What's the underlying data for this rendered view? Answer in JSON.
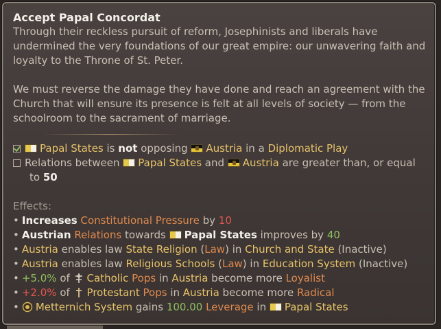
{
  "tooltip": {
    "title": "Accept Papal Concordat",
    "para1_line1": "Through their reckless pursuit of reform, Josephinists and liberals have",
    "para1_line2": "undermined the very foundations of our great empire: our unwavering faith and",
    "para1_line3": "loyalty to the Throne of St. Peter.",
    "para2_line1": "We must reverse the damage they have done and reach an agreement with the",
    "para2_line2": "Church that will ensure its presence is felt at all levels of society — from the",
    "para2_line3": "schoolroom to the sacrament of marriage."
  },
  "conditions": {
    "c1": {
      "subject": "Papal States",
      "t1": " is ",
      "not": "not",
      "t2": " opposing ",
      "target": "Austria",
      "t3": " in a ",
      "play": "Diplomatic Play"
    },
    "c2": {
      "t1": "Relations between ",
      "subject": "Papal States",
      "t2": " and ",
      "target": "Austria",
      "t3": " are greater than, or equal",
      "t4": "to ",
      "value": "50"
    }
  },
  "effects": {
    "header": "Effects:",
    "e1": {
      "verb": "Increases",
      "stat": "Constitutional Pressure",
      "t1": " by ",
      "value": "10"
    },
    "e2": {
      "a": "Austrian",
      "rel": "Relations",
      "t1": " towards ",
      "target": "Papal States",
      "t2": " improves by ",
      "value": "40"
    },
    "e3": {
      "country": "Austria",
      "t1": " enables law ",
      "law": "State Religion",
      "t2": " (",
      "lawword": "Law",
      "t3": ") in ",
      "group": "Church and State",
      "t4": " (Inactive)"
    },
    "e4": {
      "country": "Austria",
      "t1": " enables law ",
      "law": "Religious Schools",
      "t2": " (",
      "lawword": "Law",
      "t3": ") in ",
      "group": "Education System",
      "t4": " (Inactive)"
    },
    "e5": {
      "pct": "+5.0%",
      "t1": " of ",
      "rel": "Catholic",
      "pops": "Pops",
      "t2": " in ",
      "country": "Austria",
      "t3": " become more ",
      "result": "Loyalist"
    },
    "e6": {
      "pct": "+2.0%",
      "t1": " of ",
      "rel": "Protestant",
      "pops": "Pops",
      "t2": " in ",
      "country": "Austria",
      "t3": " become more ",
      "result": "Radical"
    },
    "e7": {
      "name": "Metternich System",
      "t1": " gains ",
      "value": "100.00",
      "stat": "Leverage",
      "t2": " in ",
      "target": "Papal States"
    }
  },
  "colors": {
    "highlight": "#e8c36a",
    "stat": "#e08a4e",
    "positive": "#8fc05e",
    "negative": "#e0574f"
  }
}
